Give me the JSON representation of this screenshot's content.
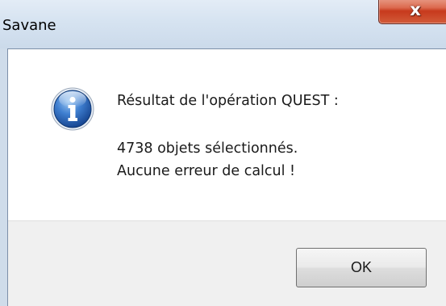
{
  "window": {
    "title": "Savane",
    "close_symbol": "x"
  },
  "dialog": {
    "icon": "info-icon",
    "heading": "Résultat de l'opération QUEST :",
    "line1": "4738 objets sélectionnés.",
    "line2": "Aucune erreur de calcul !"
  },
  "buttons": {
    "ok_label": "OK"
  },
  "colors": {
    "close_button": "#c7391c",
    "info_icon": "#1f5fb8",
    "button_area": "#f0f0f0",
    "titlebar": "#d6e3f1"
  }
}
